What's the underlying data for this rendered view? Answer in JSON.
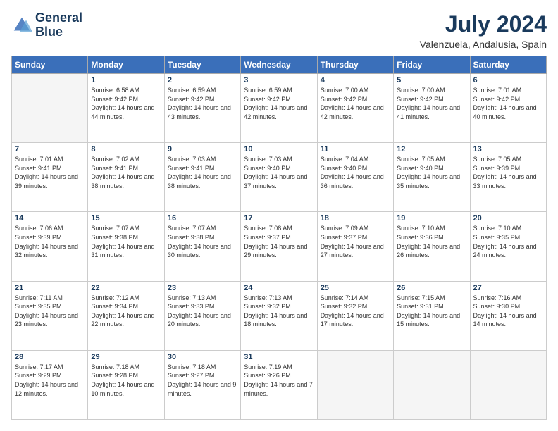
{
  "logo": {
    "line1": "General",
    "line2": "Blue"
  },
  "header": {
    "month": "July 2024",
    "location": "Valenzuela, Andalusia, Spain"
  },
  "columns": [
    "Sunday",
    "Monday",
    "Tuesday",
    "Wednesday",
    "Thursday",
    "Friday",
    "Saturday"
  ],
  "weeks": [
    [
      {
        "day": "",
        "sunrise": "",
        "sunset": "",
        "daylight": ""
      },
      {
        "day": "1",
        "sunrise": "Sunrise: 6:58 AM",
        "sunset": "Sunset: 9:42 PM",
        "daylight": "Daylight: 14 hours and 44 minutes."
      },
      {
        "day": "2",
        "sunrise": "Sunrise: 6:59 AM",
        "sunset": "Sunset: 9:42 PM",
        "daylight": "Daylight: 14 hours and 43 minutes."
      },
      {
        "day": "3",
        "sunrise": "Sunrise: 6:59 AM",
        "sunset": "Sunset: 9:42 PM",
        "daylight": "Daylight: 14 hours and 42 minutes."
      },
      {
        "day": "4",
        "sunrise": "Sunrise: 7:00 AM",
        "sunset": "Sunset: 9:42 PM",
        "daylight": "Daylight: 14 hours and 42 minutes."
      },
      {
        "day": "5",
        "sunrise": "Sunrise: 7:00 AM",
        "sunset": "Sunset: 9:42 PM",
        "daylight": "Daylight: 14 hours and 41 minutes."
      },
      {
        "day": "6",
        "sunrise": "Sunrise: 7:01 AM",
        "sunset": "Sunset: 9:42 PM",
        "daylight": "Daylight: 14 hours and 40 minutes."
      }
    ],
    [
      {
        "day": "7",
        "sunrise": "Sunrise: 7:01 AM",
        "sunset": "Sunset: 9:41 PM",
        "daylight": "Daylight: 14 hours and 39 minutes."
      },
      {
        "day": "8",
        "sunrise": "Sunrise: 7:02 AM",
        "sunset": "Sunset: 9:41 PM",
        "daylight": "Daylight: 14 hours and 38 minutes."
      },
      {
        "day": "9",
        "sunrise": "Sunrise: 7:03 AM",
        "sunset": "Sunset: 9:41 PM",
        "daylight": "Daylight: 14 hours and 38 minutes."
      },
      {
        "day": "10",
        "sunrise": "Sunrise: 7:03 AM",
        "sunset": "Sunset: 9:40 PM",
        "daylight": "Daylight: 14 hours and 37 minutes."
      },
      {
        "day": "11",
        "sunrise": "Sunrise: 7:04 AM",
        "sunset": "Sunset: 9:40 PM",
        "daylight": "Daylight: 14 hours and 36 minutes."
      },
      {
        "day": "12",
        "sunrise": "Sunrise: 7:05 AM",
        "sunset": "Sunset: 9:40 PM",
        "daylight": "Daylight: 14 hours and 35 minutes."
      },
      {
        "day": "13",
        "sunrise": "Sunrise: 7:05 AM",
        "sunset": "Sunset: 9:39 PM",
        "daylight": "Daylight: 14 hours and 33 minutes."
      }
    ],
    [
      {
        "day": "14",
        "sunrise": "Sunrise: 7:06 AM",
        "sunset": "Sunset: 9:39 PM",
        "daylight": "Daylight: 14 hours and 32 minutes."
      },
      {
        "day": "15",
        "sunrise": "Sunrise: 7:07 AM",
        "sunset": "Sunset: 9:38 PM",
        "daylight": "Daylight: 14 hours and 31 minutes."
      },
      {
        "day": "16",
        "sunrise": "Sunrise: 7:07 AM",
        "sunset": "Sunset: 9:38 PM",
        "daylight": "Daylight: 14 hours and 30 minutes."
      },
      {
        "day": "17",
        "sunrise": "Sunrise: 7:08 AM",
        "sunset": "Sunset: 9:37 PM",
        "daylight": "Daylight: 14 hours and 29 minutes."
      },
      {
        "day": "18",
        "sunrise": "Sunrise: 7:09 AM",
        "sunset": "Sunset: 9:37 PM",
        "daylight": "Daylight: 14 hours and 27 minutes."
      },
      {
        "day": "19",
        "sunrise": "Sunrise: 7:10 AM",
        "sunset": "Sunset: 9:36 PM",
        "daylight": "Daylight: 14 hours and 26 minutes."
      },
      {
        "day": "20",
        "sunrise": "Sunrise: 7:10 AM",
        "sunset": "Sunset: 9:35 PM",
        "daylight": "Daylight: 14 hours and 24 minutes."
      }
    ],
    [
      {
        "day": "21",
        "sunrise": "Sunrise: 7:11 AM",
        "sunset": "Sunset: 9:35 PM",
        "daylight": "Daylight: 14 hours and 23 minutes."
      },
      {
        "day": "22",
        "sunrise": "Sunrise: 7:12 AM",
        "sunset": "Sunset: 9:34 PM",
        "daylight": "Daylight: 14 hours and 22 minutes."
      },
      {
        "day": "23",
        "sunrise": "Sunrise: 7:13 AM",
        "sunset": "Sunset: 9:33 PM",
        "daylight": "Daylight: 14 hours and 20 minutes."
      },
      {
        "day": "24",
        "sunrise": "Sunrise: 7:13 AM",
        "sunset": "Sunset: 9:32 PM",
        "daylight": "Daylight: 14 hours and 18 minutes."
      },
      {
        "day": "25",
        "sunrise": "Sunrise: 7:14 AM",
        "sunset": "Sunset: 9:32 PM",
        "daylight": "Daylight: 14 hours and 17 minutes."
      },
      {
        "day": "26",
        "sunrise": "Sunrise: 7:15 AM",
        "sunset": "Sunset: 9:31 PM",
        "daylight": "Daylight: 14 hours and 15 minutes."
      },
      {
        "day": "27",
        "sunrise": "Sunrise: 7:16 AM",
        "sunset": "Sunset: 9:30 PM",
        "daylight": "Daylight: 14 hours and 14 minutes."
      }
    ],
    [
      {
        "day": "28",
        "sunrise": "Sunrise: 7:17 AM",
        "sunset": "Sunset: 9:29 PM",
        "daylight": "Daylight: 14 hours and 12 minutes."
      },
      {
        "day": "29",
        "sunrise": "Sunrise: 7:18 AM",
        "sunset": "Sunset: 9:28 PM",
        "daylight": "Daylight: 14 hours and 10 minutes."
      },
      {
        "day": "30",
        "sunrise": "Sunrise: 7:18 AM",
        "sunset": "Sunset: 9:27 PM",
        "daylight": "Daylight: 14 hours and 9 minutes."
      },
      {
        "day": "31",
        "sunrise": "Sunrise: 7:19 AM",
        "sunset": "Sunset: 9:26 PM",
        "daylight": "Daylight: 14 hours and 7 minutes."
      },
      {
        "day": "",
        "sunrise": "",
        "sunset": "",
        "daylight": ""
      },
      {
        "day": "",
        "sunrise": "",
        "sunset": "",
        "daylight": ""
      },
      {
        "day": "",
        "sunrise": "",
        "sunset": "",
        "daylight": ""
      }
    ]
  ]
}
